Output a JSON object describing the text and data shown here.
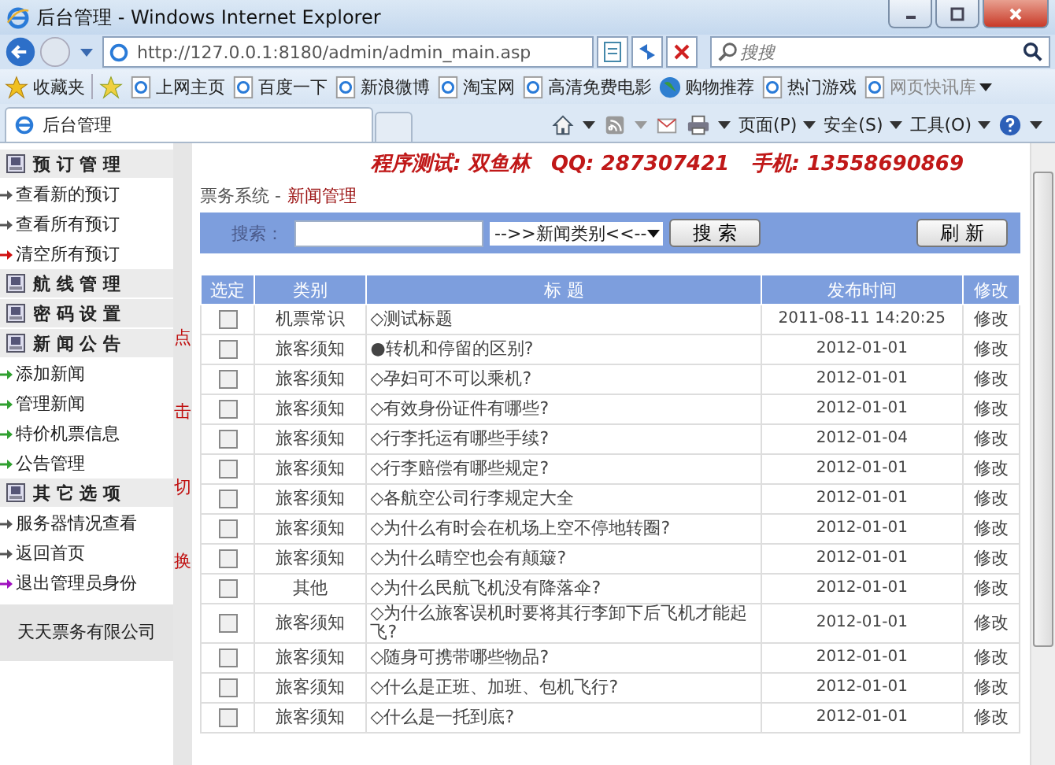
{
  "window": {
    "title": "后台管理 - Windows Internet Explorer"
  },
  "address_bar": {
    "url": "http://127.0.0.1:8180/admin/admin_main.asp"
  },
  "search_box": {
    "placeholder": "搜搜"
  },
  "favorites_bar": {
    "label": "收藏夹",
    "links": [
      {
        "label": "上网主页",
        "kind": "page"
      },
      {
        "label": "百度一下",
        "kind": "page"
      },
      {
        "label": "新浪微博",
        "kind": "page"
      },
      {
        "label": "淘宝网",
        "kind": "page"
      },
      {
        "label": "高清免费电影",
        "kind": "page"
      },
      {
        "label": "购物推荐",
        "kind": "globe"
      },
      {
        "label": "热门游戏",
        "kind": "page"
      },
      {
        "label": "网页快讯库",
        "kind": "feed"
      }
    ]
  },
  "tabs": [
    {
      "label": "后台管理",
      "selected": true
    }
  ],
  "command_bar": {
    "menus": [
      "页面(P)",
      "安全(S)",
      "工具(O)"
    ]
  },
  "sidebar": {
    "sections": [
      {
        "title": "预 订 管 理",
        "items": [
          {
            "label": "查看新的预订",
            "color": "#555555"
          },
          {
            "label": "查看所有预订",
            "color": "#555555"
          },
          {
            "label": "清空所有预订",
            "color": "#d01010"
          }
        ]
      },
      {
        "title": "航 线 管 理"
      },
      {
        "title": "密 码 设 置"
      },
      {
        "title": "新 闻 公 告",
        "items": [
          {
            "label": "添加新闻",
            "color": "#30a030"
          },
          {
            "label": "管理新闻",
            "color": "#30a030"
          },
          {
            "label": "特价机票信息",
            "color": "#30a030"
          },
          {
            "label": "公告管理",
            "color": "#30a030"
          }
        ]
      },
      {
        "title": "其 它 选 项",
        "items": [
          {
            "label": "服务器情况查看",
            "color": "#555555"
          },
          {
            "label": "返回首页",
            "color": "#555555"
          },
          {
            "label": "退出管理员身份",
            "color": "#a010c0"
          }
        ]
      }
    ],
    "footer": "天天票务有限公司"
  },
  "toggle_label": "点击切换",
  "banner": "程序测试: 双鱼林   QQ: 287307421   手机: 13558690869",
  "breadcrumb": {
    "root": "票务系统 -",
    "current": "新闻管理"
  },
  "search_form": {
    "label": "搜索：",
    "category": "-->>新闻类别<<--",
    "search_button": "搜 索",
    "refresh_button": "刷 新"
  },
  "table": {
    "columns": [
      "选定",
      "类别",
      "标 题",
      "发布时间",
      "修改"
    ],
    "rows": [
      {
        "checked": false,
        "category": "机票常识",
        "title": "◇测试标题",
        "date": "2011-08-11 14:20:25",
        "action": "修改"
      },
      {
        "checked": false,
        "category": "旅客须知",
        "title": "●转机和停留的区别?",
        "date": "2012-01-01",
        "action": "修改"
      },
      {
        "checked": false,
        "category": "旅客须知",
        "title": "◇孕妇可不可以乘机?",
        "date": "2012-01-01",
        "action": "修改"
      },
      {
        "checked": false,
        "category": "旅客须知",
        "title": "◇有效身份证件有哪些?",
        "date": "2012-01-01",
        "action": "修改"
      },
      {
        "checked": false,
        "category": "旅客须知",
        "title": "◇行李托运有哪些手续?",
        "date": "2012-01-04",
        "action": "修改"
      },
      {
        "checked": false,
        "category": "旅客须知",
        "title": "◇行李赔偿有哪些规定?",
        "date": "2012-01-01",
        "action": "修改"
      },
      {
        "checked": false,
        "category": "旅客须知",
        "title": "◇各航空公司行李规定大全",
        "date": "2012-01-01",
        "action": "修改"
      },
      {
        "checked": false,
        "category": "旅客须知",
        "title": "◇为什么有时会在机场上空不停地转圈?",
        "date": "2012-01-01",
        "action": "修改"
      },
      {
        "checked": false,
        "category": "旅客须知",
        "title": "◇为什么晴空也会有颠簸?",
        "date": "2012-01-01",
        "action": "修改"
      },
      {
        "checked": false,
        "category": "其他",
        "title": "◇为什么民航飞机没有降落伞?",
        "date": "2012-01-01",
        "action": "修改"
      },
      {
        "checked": false,
        "category": "旅客须知",
        "title": "◇为什么旅客误机时要将其行李卸下后飞机才能起飞?",
        "date": "2012-01-01",
        "action": "修改"
      },
      {
        "checked": false,
        "category": "旅客须知",
        "title": "◇随身可携带哪些物品?",
        "date": "2012-01-01",
        "action": "修改"
      },
      {
        "checked": false,
        "category": "旅客须知",
        "title": "◇什么是正班、加班、包机飞行?",
        "date": "2012-01-01",
        "action": "修改"
      },
      {
        "checked": false,
        "category": "旅客须知",
        "title": "◇什么是一托到底?",
        "date": "2012-01-01",
        "action": "修改"
      }
    ]
  }
}
